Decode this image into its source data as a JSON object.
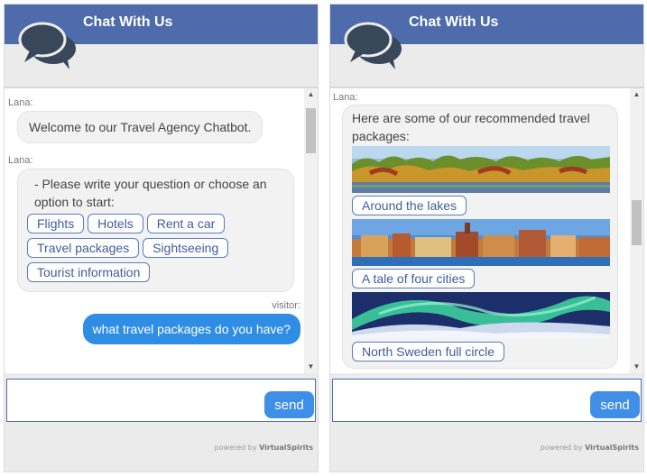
{
  "left": {
    "header_title": "Chat With Us",
    "messages": {
      "bot1_sender": "Lana:",
      "bot1_text": "Welcome to our Travel Agency Chatbot.",
      "bot2_sender": "Lana:",
      "bot2_text": "- Please write your question or choose an option to start:",
      "options": [
        "Flights",
        "Hotels",
        "Rent a car",
        "Travel packages",
        "Sightseeing",
        "Tourist information"
      ],
      "visitor_label": "visitor:",
      "visitor_text": "what travel packages do you have?"
    },
    "input": {
      "value": "",
      "placeholder": ""
    },
    "send_label": "send",
    "powered_prefix": "powered by",
    "powered_brand": "VirtualSpirits"
  },
  "right": {
    "header_title": "Chat With Us",
    "messages": {
      "bot_sender": "Lana:",
      "bot_text": "Here are some of our recommended travel packages:",
      "packages": [
        {
          "label": "Around the lakes",
          "image": "lake-forest-photo"
        },
        {
          "label": "A tale of four cities",
          "image": "old-town-waterfront-photo"
        },
        {
          "label": "North Sweden full circle",
          "image": "northern-lights-photo"
        }
      ]
    },
    "input": {
      "value": "",
      "placeholder": ""
    },
    "send_label": "send",
    "powered_prefix": "powered by",
    "powered_brand": "VirtualSpirits"
  },
  "colors": {
    "header": "#4e6bab",
    "visitor_bubble": "#2f8de4",
    "send_button": "#3f8fe8",
    "option_border": "#5a7bbd"
  }
}
